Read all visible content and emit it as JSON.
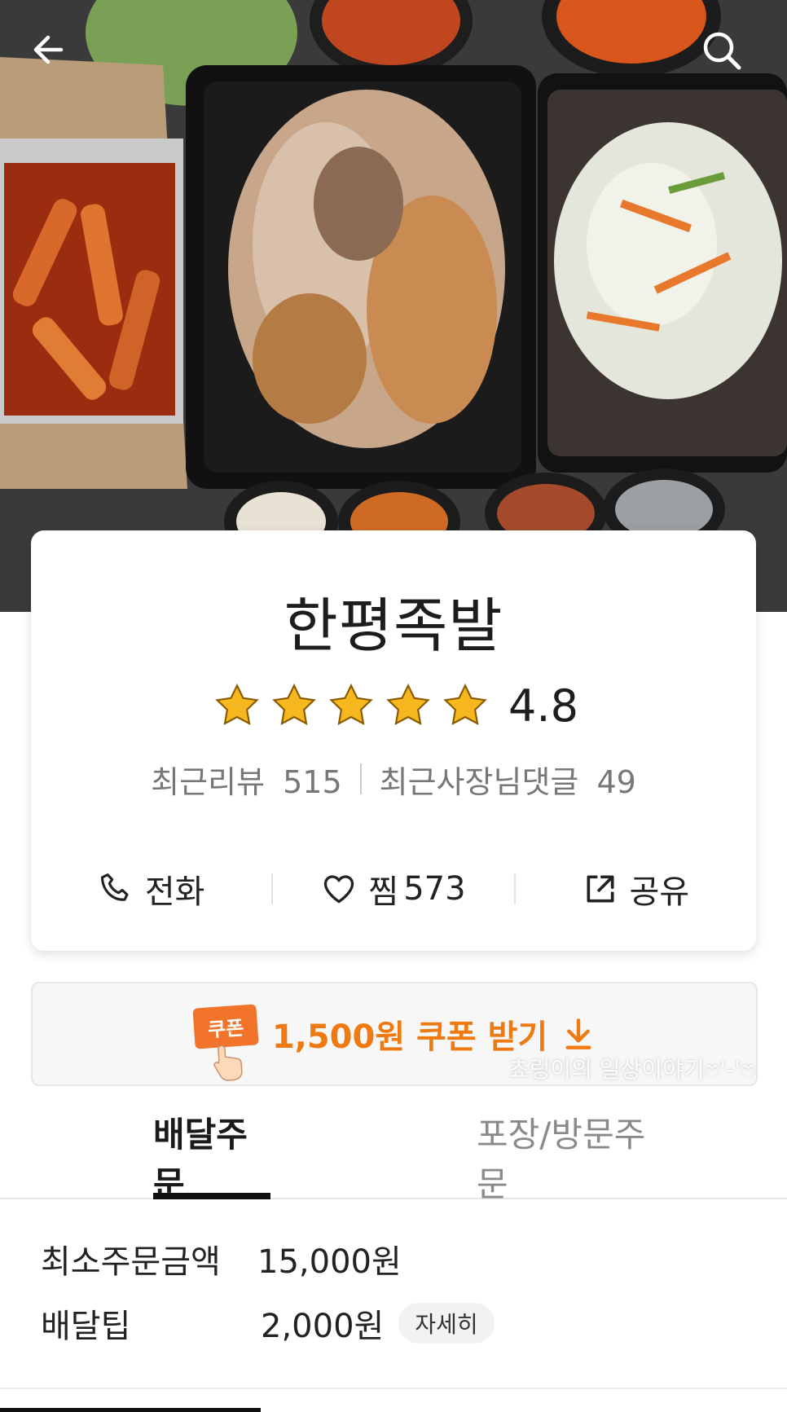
{
  "store": {
    "name": "한평족발",
    "rating": "4.8",
    "stars": 5,
    "recent_reviews_label": "최근리뷰",
    "recent_reviews_count": "515",
    "owner_replies_label": "최근사장님댓글",
    "owner_replies_count": "49"
  },
  "actions": {
    "call_label": "전화",
    "favorite_label": "찜",
    "favorite_count": "573",
    "share_label": "공유"
  },
  "coupon": {
    "badge": "쿠폰",
    "text": "1,500원 쿠폰 받기"
  },
  "watermark": "쵸링이의 일상이야기ෆ'-'ෆ",
  "tabs": {
    "delivery": "배달주문",
    "pickup": "포장/방문주문",
    "active": "delivery"
  },
  "info": {
    "min_order_label": "최소주문금액",
    "min_order_value": "15,000원",
    "delivery_tip_label": "배달팁",
    "delivery_tip_value": "2,000원",
    "detail_button": "자세히"
  },
  "icons": {
    "back": "arrow-left-icon",
    "search": "search-icon",
    "call": "phone-icon",
    "favorite": "heart-icon",
    "share": "share-icon",
    "coupon_download": "download-arrow-icon"
  },
  "colors": {
    "accent": "#f07a12",
    "star": "#f6b81e"
  }
}
